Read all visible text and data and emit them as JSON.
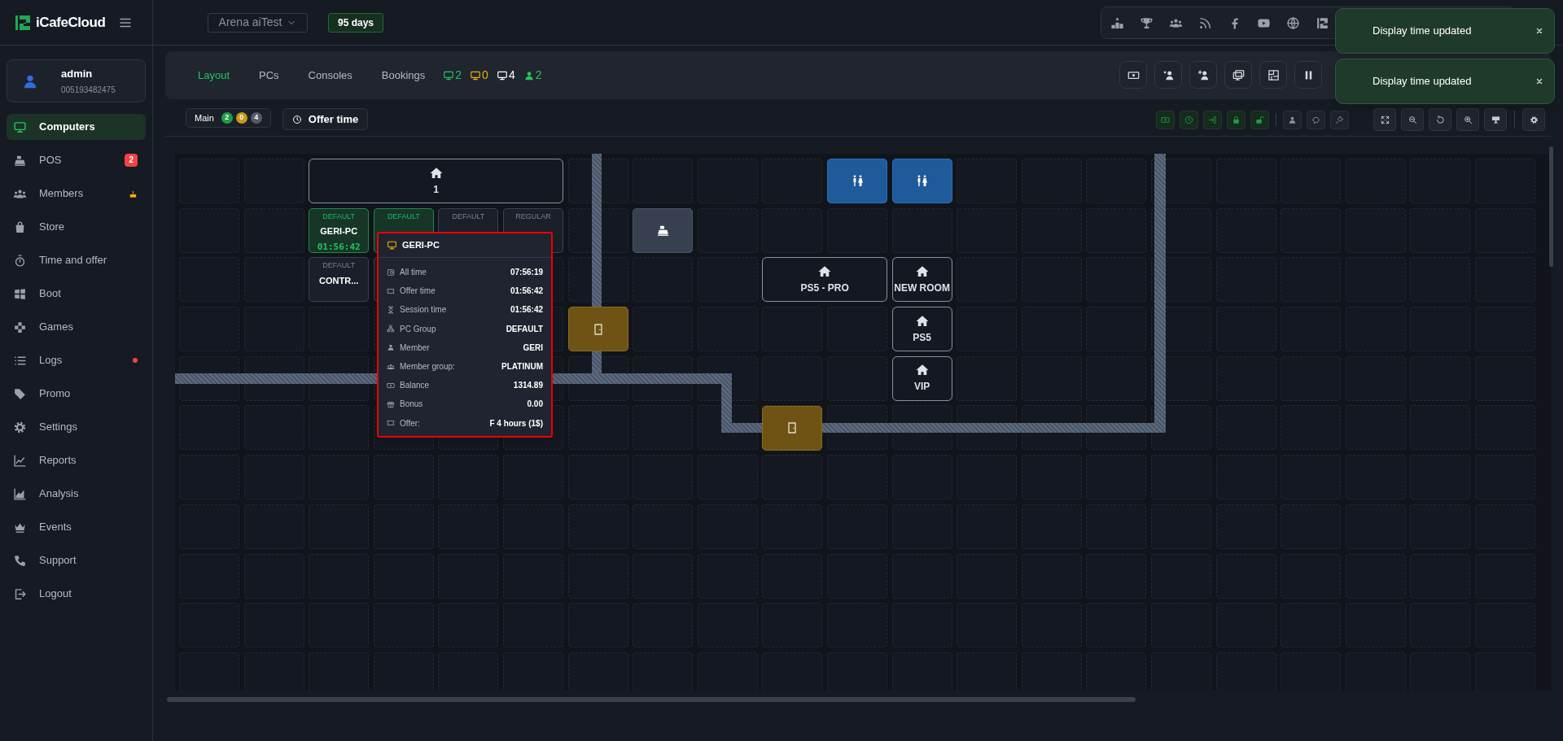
{
  "brand": {
    "name": "iCafeCloud"
  },
  "workspace": {
    "label": "Arena aiTest"
  },
  "license": {
    "label": "95 days"
  },
  "user": {
    "name": "admin",
    "id": "005193482475"
  },
  "sidebar": {
    "items": [
      {
        "label": "Computers",
        "selected": true,
        "birthday": false,
        "alert": false
      },
      {
        "label": "POS",
        "selected": false,
        "badge": "2",
        "birthday": false,
        "alert": false
      },
      {
        "label": "Members",
        "selected": false,
        "birthday": true,
        "alert": false
      },
      {
        "label": "Store",
        "selected": false,
        "birthday": false,
        "alert": false
      },
      {
        "label": "Time and offer",
        "selected": false,
        "birthday": false,
        "alert": false
      },
      {
        "label": "Boot",
        "selected": false,
        "birthday": false,
        "alert": false
      },
      {
        "label": "Games",
        "selected": false,
        "birthday": false,
        "alert": false
      },
      {
        "label": "Logs",
        "selected": false,
        "birthday": false,
        "alert": true
      },
      {
        "label": "Promo",
        "selected": false,
        "birthday": false,
        "alert": false
      },
      {
        "label": "Settings",
        "selected": false,
        "birthday": false,
        "alert": false
      },
      {
        "label": "Reports",
        "selected": false,
        "birthday": false,
        "alert": false
      },
      {
        "label": "Analysis",
        "selected": false,
        "birthday": false,
        "alert": false
      },
      {
        "label": "Events",
        "selected": false,
        "birthday": false,
        "alert": false
      },
      {
        "label": "Support",
        "selected": false,
        "birthday": false,
        "alert": false
      },
      {
        "label": "Logout",
        "selected": false,
        "birthday": false,
        "alert": false
      }
    ]
  },
  "tabs": [
    {
      "label": "Layout",
      "selected": true
    },
    {
      "label": "PCs",
      "selected": false
    },
    {
      "label": "Consoles",
      "selected": false
    },
    {
      "label": "Bookings",
      "selected": false
    }
  ],
  "stats": [
    {
      "kind": "pc",
      "value": "2",
      "color": "#22c55e"
    },
    {
      "kind": "pc",
      "value": "0",
      "color": "#eab308"
    },
    {
      "kind": "pc",
      "value": "4",
      "color": "#ffffff"
    },
    {
      "kind": "member",
      "value": "2",
      "color": "#22c55e"
    }
  ],
  "floor": {
    "label": "Main",
    "counts": [
      {
        "value": "2",
        "color": "#1f9d45"
      },
      {
        "value": "0",
        "color": "#c99a17"
      },
      {
        "value": "4",
        "color": "#555b66"
      }
    ]
  },
  "offer_button": {
    "label": "Offer time"
  },
  "toasts": [
    {
      "message": "Display time updated"
    },
    {
      "message": "Display time updated"
    }
  ],
  "layout": {
    "items": [
      {
        "kind": "room",
        "label": "1"
      },
      {
        "kind": "pc",
        "group": "DEFAULT",
        "name": "GERI-PC",
        "time": "01:56:42",
        "active": true
      },
      {
        "kind": "pc",
        "group": "DEFAULT",
        "active": true
      },
      {
        "kind": "pc",
        "group": "DEFAULT",
        "active": false
      },
      {
        "kind": "pc",
        "group": "REGULAR",
        "active": false
      },
      {
        "kind": "pc",
        "group": "DEFAULT",
        "name": "CONTR...",
        "active": false
      },
      {
        "kind": "pc",
        "active": false
      },
      {
        "kind": "toilet"
      },
      {
        "kind": "toilet"
      },
      {
        "kind": "cashier"
      },
      {
        "kind": "room",
        "label": "PS5 - PRO"
      },
      {
        "kind": "room",
        "label": "NEW ROOM"
      },
      {
        "kind": "room",
        "label": "PS5"
      },
      {
        "kind": "room",
        "label": "VIP"
      },
      {
        "kind": "door"
      },
      {
        "kind": "door"
      }
    ]
  },
  "tooltip": {
    "title": "GERI-PC",
    "rows": [
      {
        "label": "All time",
        "value": "07:56:19"
      },
      {
        "label": "Offer time",
        "value": "01:56:42"
      },
      {
        "label": "Session time",
        "value": "01:56:42"
      },
      {
        "label": "PC Group",
        "value": "DEFAULT"
      },
      {
        "label": "Member",
        "value": "GERI"
      },
      {
        "label": "Member group:",
        "value": "PLATINUM"
      },
      {
        "label": "Balance",
        "value": "1314.89"
      },
      {
        "label": "Bonus",
        "value": "0.00"
      },
      {
        "label": "Offer:",
        "value": "F 4 hours (1$)"
      }
    ]
  }
}
